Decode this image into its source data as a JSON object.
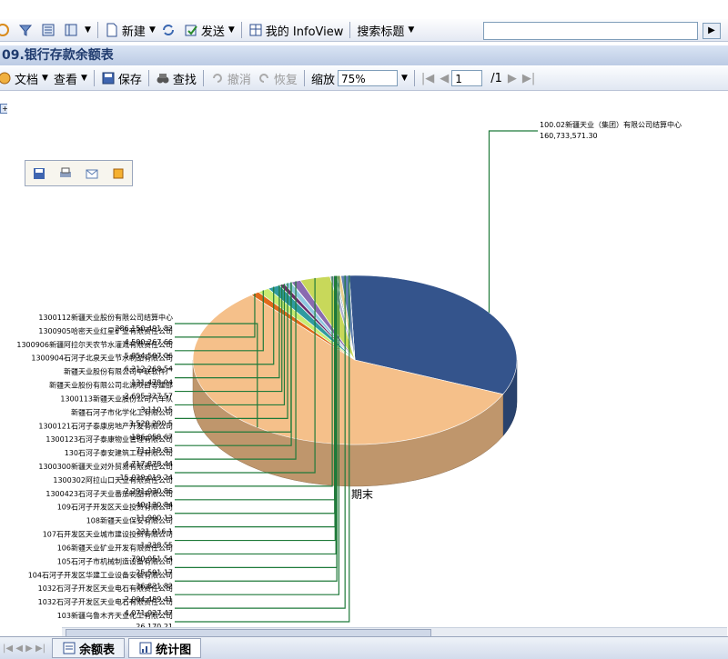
{
  "toolbar": {
    "new_label": "新建",
    "send_label": "发送",
    "myinfoview_label": "我的 InfoView",
    "search_title_label": "搜索标题",
    "search_value": ""
  },
  "report": {
    "title": "09.银行存款余额表"
  },
  "report_toolbar": {
    "document_label": "文档",
    "view_label": "查看",
    "save_label": "保存",
    "find_label": "查找",
    "undo_label": "撤消",
    "redo_label": "恢复",
    "zoom_label": "缩放",
    "zoom_value": "75%",
    "page_value": "1",
    "page_total": "/1"
  },
  "tabs": [
    {
      "label": "余额表"
    },
    {
      "label": "统计图"
    }
  ],
  "colors": {
    "slice_orange": "#f5c08a",
    "slice_green": "#c9ec72",
    "slice_navy": "#34548c",
    "slice_yellow": "#f2e03a",
    "slice_teal": "#2f9aa0",
    "accent_orange": "#e06a1b",
    "leader_green": "#1f7a3a"
  },
  "chart_data": {
    "type": "pie",
    "title": "",
    "center_label": "期末",
    "slices": [
      {
        "label": "100.02新疆天业（集团）有限公司结算中心",
        "value": "160,733,571.30"
      },
      {
        "label": "1300112新疆天业股份有限公司结算中心",
        "value": "286,150,491.82"
      },
      {
        "label": "1300905哈密天业红星矿业有限责任公司",
        "value": "4,500,267.66"
      },
      {
        "label": "1300906新疆阿拉尔天农节水灌溉有限责任公司",
        "value": "5,854,507.06"
      },
      {
        "label": "1300904石河子北泉天业节水制品有限公司",
        "value": "6,212,268.54"
      },
      {
        "label": "新疆天业股份有限公司中联软件厂",
        "value": "131,478.94"
      },
      {
        "label": "新疆天业股份有限公司北湖项目等建部",
        "value": "2,695,327.57"
      },
      {
        "label": "1300113新疆天业股份公司汽车队",
        "value": "3,110.15"
      },
      {
        "label": "新疆石河子市化学化工有限公司",
        "value": "3,520,290.5"
      },
      {
        "label": "1300121石河子泰康房地产开发有限公司",
        "value": "186,058.67"
      },
      {
        "label": "1300123石河子泰康物业管理有限公司",
        "value": "71,119.83"
      },
      {
        "label": "130石河子泰安建筑工程有限公司",
        "value": "4,717,878.44"
      },
      {
        "label": "1300300新疆天业对外贸易有限责任公司",
        "value": "15,029,019.24"
      },
      {
        "label": "1300302阿拉山口天业有限责任公司",
        "value": "2,291,030.86"
      },
      {
        "label": "1300423石河子天业番茄制品有限公司",
        "value": "40,130.84"
      },
      {
        "label": "109石河子开发区天业投资有限公司",
        "value": "11,900.13"
      },
      {
        "label": "108新疆天业保安有限公司",
        "value": "231,016.1"
      },
      {
        "label": "107石开发区天业城市建设投资有限公司",
        "value": "1,338.55"
      },
      {
        "label": "106新疆天业矿业开发有限责任公司",
        "value": "790,051.54"
      },
      {
        "label": "105石河子市机械制造设备有限公司",
        "value": "25,591.17"
      },
      {
        "label": "104石河子开发区华建工业设备安装有限公司",
        "value": "26,821.82"
      },
      {
        "label": "1032石河子开发区天业电石有限责任公司",
        "value": "2,004,489.41"
      },
      {
        "label": "1032石河子开发区天业电石有限责任公司",
        "value": "4,071,027.47"
      },
      {
        "label": "103新疆乌鲁木齐天业化工有限公司",
        "value": "26,170.21"
      }
    ]
  }
}
